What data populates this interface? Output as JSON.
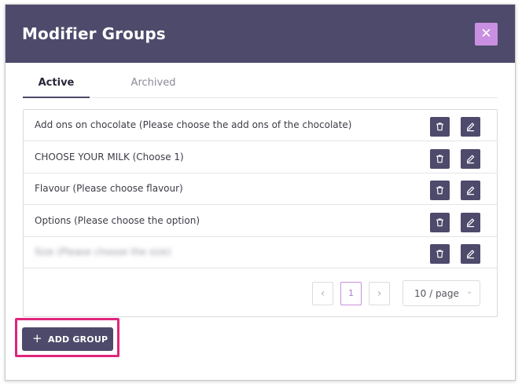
{
  "modal": {
    "title": "Modifier Groups",
    "close_glyph": "✕"
  },
  "tabs": [
    {
      "label": "Active",
      "active": true
    },
    {
      "label": "Archived",
      "active": false
    }
  ],
  "groups": [
    {
      "label": "Add ons on chocolate (Please choose the add ons of the chocolate)",
      "blurred": false
    },
    {
      "label": "CHOOSE YOUR MILK (Choose 1)",
      "blurred": false
    },
    {
      "label": "Flavour (Please choose flavour)",
      "blurred": false
    },
    {
      "label": "Options (Please choose the option)",
      "blurred": false
    },
    {
      "label": "Size (Please choose the size)",
      "blurred": true
    }
  ],
  "row_actions": {
    "delete_icon": "trash-icon",
    "edit_icon": "pencil-icon"
  },
  "pagination": {
    "prev_glyph": "‹",
    "current_page": "1",
    "next_glyph": "›",
    "page_size": "10 / page"
  },
  "add_group": {
    "icon": "+",
    "label": "ADD GROUP"
  },
  "colors": {
    "header_bg": "#4d4a6b",
    "accent": "#c98fe0",
    "highlight": "#e0257e"
  }
}
